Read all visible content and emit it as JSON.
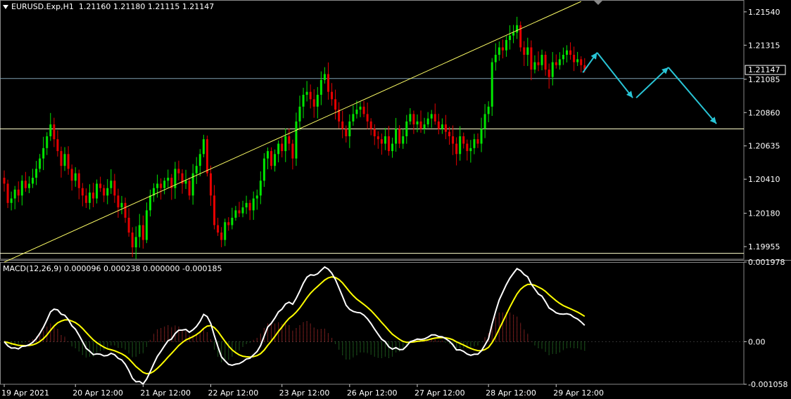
{
  "header": {
    "symbol": "EURUSD.Exp,H1",
    "ohlc": "1.21160 1.21180 1.21115 1.21147",
    "macd_label": "MACD(12,26,9) 0.000096 0.000238 0.000000 -0.000185"
  },
  "colors": {
    "background": "#000000",
    "bull": "#00e600",
    "bear": "#e60000",
    "trend": "#ffff66",
    "hline": "#ffffcc",
    "arrow": "#29c5d6",
    "macd_main": "#ffffff",
    "macd_signal": "#ffff00",
    "hist_pos": "#c83232",
    "hist_neg": "#2e8b2e"
  },
  "chart_data": [
    {
      "type": "candlestick",
      "ylim": [
        1.1987,
        1.2162
      ],
      "y_ticks": [
        "1.21540",
        "1.21315",
        "1.21085",
        "1.20860",
        "1.20635",
        "1.20410",
        "1.20180",
        "1.19955"
      ],
      "y_tick_values": [
        1.2154,
        1.21315,
        1.21085,
        1.2086,
        1.20635,
        1.2041,
        1.2018,
        1.19955
      ],
      "current_price": "1.21147",
      "horizontal_levels": [
        1.2109,
        1.2075,
        1.1991
      ],
      "trendline": {
        "from": [
          0,
          1.1985
        ],
        "to": [
          162,
          1.2161
        ]
      },
      "x_labels": [
        "19 Apr 2021",
        "20 Apr 12:00",
        "21 Apr 12:00",
        "22 Apr 12:00",
        "23 Apr 12:00",
        "26 Apr 12:00",
        "27 Apr 12:00",
        "28 Apr 12:00",
        "29 Apr 12:00"
      ],
      "x_label_bars": [
        0,
        20,
        39,
        58,
        78,
        97,
        116,
        136,
        155
      ],
      "closes": [
        1.2038,
        1.2025,
        1.2028,
        1.2034,
        1.203,
        1.204,
        1.2035,
        1.2038,
        1.2042,
        1.2048,
        1.2055,
        1.2062,
        1.207,
        1.2078,
        1.2068,
        1.206,
        1.205,
        1.2058,
        1.2048,
        1.204,
        1.2045,
        1.2035,
        1.203,
        1.2025,
        1.2032,
        1.2028,
        1.2038,
        1.2035,
        1.203,
        1.2035,
        1.204,
        1.203,
        1.2022,
        1.2025,
        1.2015,
        1.2005,
        1.1995,
        1.2002,
        1.201,
        1.2,
        1.202,
        1.203,
        1.2035,
        1.2038,
        1.2035,
        1.204,
        1.2042,
        1.2035,
        1.2048,
        1.2045,
        1.2038,
        1.204,
        1.203,
        1.2045,
        1.205,
        1.2058,
        1.2068,
        1.2045,
        1.203,
        1.201,
        1.2005,
        1.2,
        1.2012,
        1.201,
        1.2015,
        1.202,
        1.2018,
        1.2022,
        1.2025,
        1.202,
        1.2028,
        1.203,
        1.204,
        1.2055,
        1.206,
        1.205,
        1.2058,
        1.2065,
        1.206,
        1.207,
        1.2065,
        1.2055,
        1.208,
        1.209,
        1.2098,
        1.21,
        1.2095,
        1.209,
        1.2098,
        1.2108,
        1.2112,
        1.21,
        1.2095,
        1.2088,
        1.208,
        1.2075,
        1.207,
        1.208,
        1.2085,
        1.2088,
        1.209,
        1.2085,
        1.208,
        1.2075,
        1.207,
        1.2068,
        1.2065,
        1.207,
        1.206,
        1.2065,
        1.2075,
        1.2065,
        1.207,
        1.208,
        1.2085,
        1.2078,
        1.208,
        1.2075,
        1.2078,
        1.2082,
        1.2085,
        1.208,
        1.2075,
        1.2078,
        1.2073,
        1.207,
        1.2065,
        1.2058,
        1.207,
        1.2065,
        1.206,
        1.2062,
        1.2068,
        1.2065,
        1.2075,
        1.2085,
        1.209,
        1.212,
        1.2125,
        1.213,
        1.2128,
        1.2135,
        1.2138,
        1.214,
        1.2145,
        1.213,
        1.2125,
        1.213,
        1.2115,
        1.212,
        1.2118,
        1.2125,
        1.2115,
        1.211,
        1.212,
        1.2118,
        1.2122,
        1.2125,
        1.2128,
        1.2125,
        1.212,
        1.2122,
        1.2118,
        1.2115
      ],
      "forecast_arrows": [
        {
          "from": [
            162.5,
            1.2113
          ],
          "to": [
            166.5,
            1.21265
          ]
        },
        {
          "from": [
            166.5,
            1.21265
          ],
          "to": [
            176.5,
            1.2096
          ]
        },
        {
          "from": [
            177.5,
            1.2096
          ],
          "to": [
            186.5,
            1.21165
          ]
        },
        {
          "from": [
            186.5,
            1.21165
          ],
          "to": [
            200.0,
            1.20785
          ]
        }
      ]
    },
    {
      "type": "macd",
      "params": "12,26,9",
      "ylim": [
        -0.001058,
        0.001978
      ],
      "y_ticks": [
        "0.001978",
        "0.00",
        "-0.001058"
      ],
      "y_tick_values": [
        0.001978,
        0.0,
        -0.001058
      ]
    }
  ]
}
